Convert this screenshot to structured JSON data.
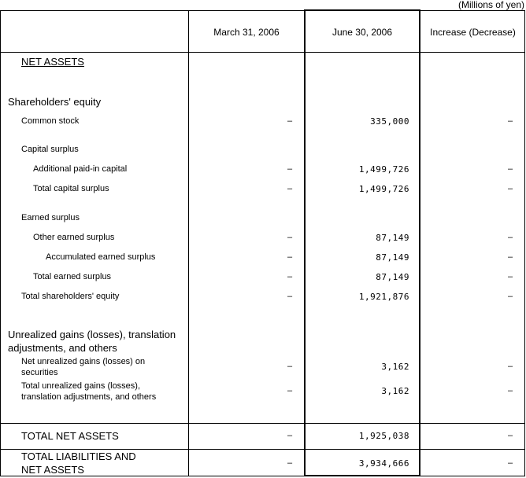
{
  "unit_note": "(Millions of yen)",
  "header": {
    "col_label": "",
    "col_march": "March 31, 2006",
    "col_june": "June 30, 2006",
    "col_change": "Increase (Decrease)"
  },
  "rows": {
    "net_assets": {
      "label": "NET ASSETS"
    },
    "shareholders_equity": {
      "label": "Shareholders' equity"
    },
    "common_stock": {
      "label": "Common stock",
      "march": "–",
      "june": "335,000",
      "change": "–"
    },
    "capital_surplus": {
      "label": "Capital surplus"
    },
    "additional_paid_in": {
      "label": "Additional paid-in capital",
      "march": "–",
      "june": "1,499,726",
      "change": "–"
    },
    "total_capital_surplus": {
      "label": "Total capital surplus",
      "march": "–",
      "june": "1,499,726",
      "change": "–"
    },
    "earned_surplus": {
      "label": "Earned surplus"
    },
    "other_earned_surplus": {
      "label": "Other earned surplus",
      "march": "–",
      "june": "87,149",
      "change": "–"
    },
    "accumulated_earned_surplus": {
      "label": "Accumulated earned surplus",
      "march": "–",
      "june": "87,149",
      "change": "–"
    },
    "total_earned_surplus": {
      "label": "Total earned surplus",
      "march": "–",
      "june": "87,149",
      "change": "–"
    },
    "total_shareholders_equity": {
      "label": "Total shareholders' equity",
      "march": "–",
      "june": "1,921,876",
      "change": "–"
    },
    "unrealized_heading": {
      "line1": "Unrealized gains (losses), translation",
      "line2": "adjustments, and others"
    },
    "net_unrealized": {
      "line1": "Net unrealized gains (losses) on",
      "line2": "securities",
      "march": "–",
      "june": "3,162",
      "change": "–"
    },
    "total_unrealized": {
      "line1": "Total unrealized gains (losses),",
      "line2": "translation adjustments, and others",
      "march": "–",
      "june": "3,162",
      "change": "–"
    },
    "total_net_assets": {
      "label": "TOTAL NET ASSETS",
      "march": "–",
      "june": "1,925,038",
      "change": "–"
    },
    "total_liabilities_net_assets": {
      "line1": "TOTAL LIABILITIES AND",
      "line2": "NET ASSETS",
      "march": "–",
      "june": "3,934,666",
      "change": "–"
    }
  }
}
